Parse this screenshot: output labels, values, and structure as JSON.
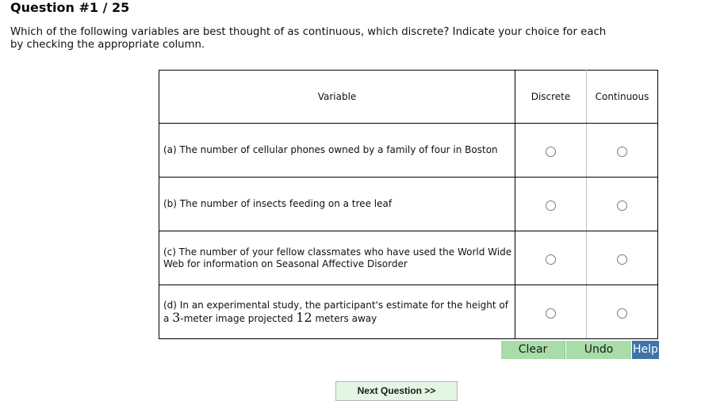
{
  "question": {
    "title": "Question #1 / 25",
    "prompt": "Which of the following variables are best thought of as continuous, which discrete? Indicate your choice for each by checking the appropriate column."
  },
  "table": {
    "headers": {
      "variable": "Variable",
      "discrete": "Discrete",
      "continuous": "Continuous"
    },
    "rows": [
      {
        "label": "(a) The number of cellular phones owned by a family of four in Boston",
        "discrete_selected": false,
        "continuous_selected": false
      },
      {
        "label": "(b) The number of insects feeding on a tree leaf",
        "discrete_selected": false,
        "continuous_selected": false
      },
      {
        "label": "(c) The number of your fellow classmates who have used the World Wide Web for information on Seasonal Affective Disorder",
        "discrete_selected": false,
        "continuous_selected": false
      },
      {
        "label_parts": {
          "line1": "(d) In an experimental study, the participant's estimate for the height of",
          "prefix": "a ",
          "num1": "3",
          "middle": "-meter image projected ",
          "num2": "12",
          "suffix": " meters away"
        },
        "discrete_selected": false,
        "continuous_selected": false
      }
    ]
  },
  "buttons": {
    "clear": "Clear",
    "undo": "Undo",
    "help": "Help",
    "next": "Next Question >>"
  },
  "colors": {
    "action_button_bg": "#a8dca8",
    "help_button_bg": "#3f74a8",
    "next_button_bg": "#e3f5e3"
  }
}
